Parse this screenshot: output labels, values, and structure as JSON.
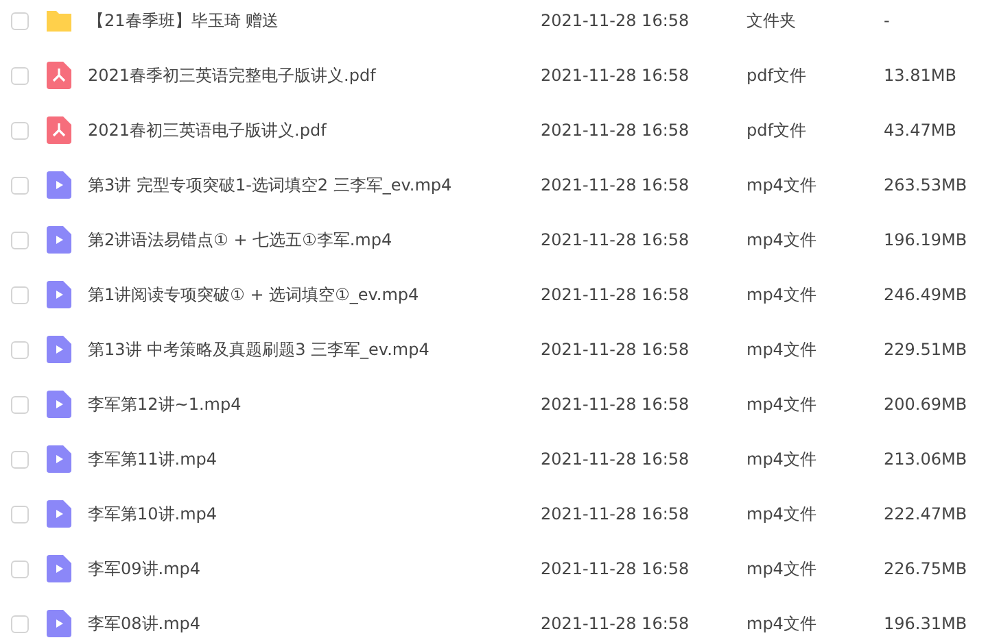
{
  "files": [
    {
      "kind": "folder",
      "checked": false,
      "name": "【21春季班】毕玉琦 赠送",
      "modified": "2021-11-28 16:58",
      "type": "文件夹",
      "size": "-"
    },
    {
      "kind": "pdf",
      "checked": false,
      "name": "2021春季初三英语完整电子版讲义.pdf",
      "modified": "2021-11-28 16:58",
      "type": "pdf文件",
      "size": "13.81MB"
    },
    {
      "kind": "pdf",
      "checked": false,
      "name": "2021春初三英语电子版讲义.pdf",
      "modified": "2021-11-28 16:58",
      "type": "pdf文件",
      "size": "43.47MB"
    },
    {
      "kind": "video",
      "checked": false,
      "name": "第3讲 完型专项突破1-选词填空2 三李军_ev.mp4",
      "modified": "2021-11-28 16:58",
      "type": "mp4文件",
      "size": "263.53MB"
    },
    {
      "kind": "video",
      "checked": false,
      "name": "第2讲语法易错点① + 七选五①李军.mp4",
      "modified": "2021-11-28 16:58",
      "type": "mp4文件",
      "size": "196.19MB"
    },
    {
      "kind": "video",
      "checked": false,
      "name": "第1讲阅读专项突破① + 选词填空①_ev.mp4",
      "modified": "2021-11-28 16:58",
      "type": "mp4文件",
      "size": "246.49MB"
    },
    {
      "kind": "video",
      "checked": false,
      "name": "第13讲 中考策略及真题刷题3 三李军_ev.mp4",
      "modified": "2021-11-28 16:58",
      "type": "mp4文件",
      "size": "229.51MB"
    },
    {
      "kind": "video",
      "checked": false,
      "name": "李军第12讲~1.mp4",
      "modified": "2021-11-28 16:58",
      "type": "mp4文件",
      "size": "200.69MB"
    },
    {
      "kind": "video",
      "checked": false,
      "name": "李军第11讲.mp4",
      "modified": "2021-11-28 16:58",
      "type": "mp4文件",
      "size": "213.06MB"
    },
    {
      "kind": "video",
      "checked": false,
      "name": "李军第10讲.mp4",
      "modified": "2021-11-28 16:58",
      "type": "mp4文件",
      "size": "222.47MB"
    },
    {
      "kind": "video",
      "checked": false,
      "name": "李军09讲.mp4",
      "modified": "2021-11-28 16:58",
      "type": "mp4文件",
      "size": "226.75MB"
    },
    {
      "kind": "video",
      "checked": false,
      "name": "李军08讲.mp4",
      "modified": "2021-11-28 16:58",
      "type": "mp4文件",
      "size": "196.31MB"
    }
  ]
}
